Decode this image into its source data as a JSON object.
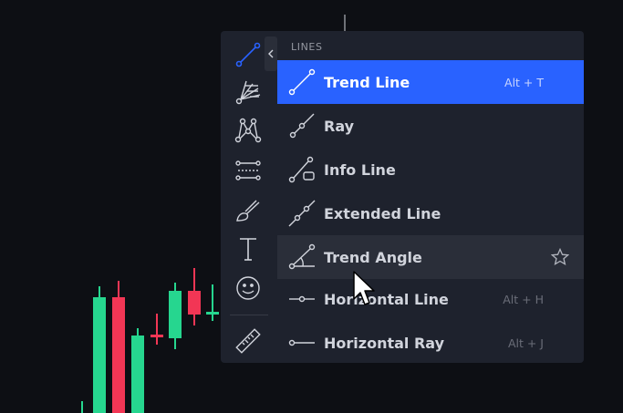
{
  "menu": {
    "header": "LINES",
    "items": [
      {
        "label": "Trend Line",
        "shortcut": "Alt + T",
        "icon": "trend-line-icon"
      },
      {
        "label": "Ray",
        "shortcut": "",
        "icon": "ray-icon"
      },
      {
        "label": "Info Line",
        "shortcut": "",
        "icon": "info-line-icon"
      },
      {
        "label": "Extended Line",
        "shortcut": "",
        "icon": "extended-line-icon"
      },
      {
        "label": "Trend Angle",
        "shortcut": "",
        "icon": "trend-angle-icon"
      },
      {
        "label": "Horizontal Line",
        "shortcut": "Alt + H",
        "icon": "horizontal-line-icon"
      },
      {
        "label": "Horizontal Ray",
        "shortcut": "Alt + J",
        "icon": "horizontal-ray-icon"
      }
    ]
  },
  "toolbar": {
    "tools": [
      "trend-line-tool-icon",
      "gann-fib-tool-icon",
      "patterns-tool-icon",
      "forecasting-tool-icon",
      "brush-tool-icon",
      "text-tool-icon",
      "emoji-tool-icon",
      "ruler-tool-icon"
    ]
  },
  "colors": {
    "accent": "#2962ff",
    "bull": "#26d68f",
    "bear": "#f23655",
    "panel": "#1e222d",
    "background": "#0d0f14"
  }
}
